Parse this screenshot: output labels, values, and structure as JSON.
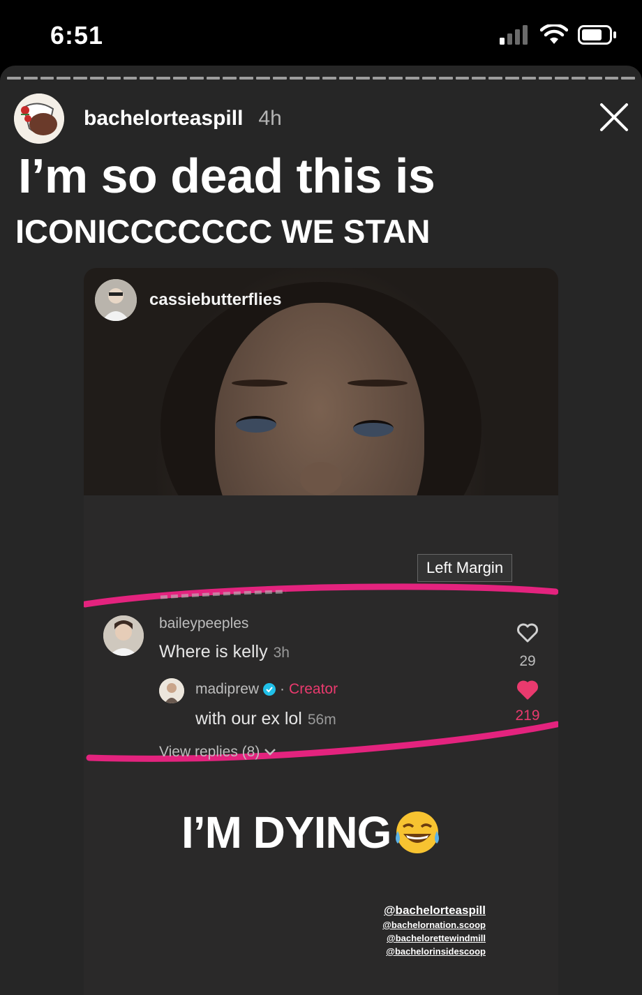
{
  "status": {
    "time": "6:51"
  },
  "story": {
    "username": "bachelorteaspill",
    "time_ago": "4h",
    "caption_line1": "I’m so dead this is",
    "caption_line2": "ICONICCCCCCC WE STAN",
    "progress_segments": 38
  },
  "post": {
    "username": "cassiebutterflies",
    "tooltip": "Left Margin",
    "comment": {
      "user": "baileypeeples",
      "text": "Where is kelly",
      "time": "3h",
      "likes": "29"
    },
    "reply": {
      "user": "madiprew",
      "badge": "Creator",
      "text": "with our ex lol",
      "time": "56m",
      "likes": "219"
    },
    "view_replies": "View replies (8)",
    "overlay_text": "I’M DYING",
    "credits": [
      "@bachelorteaspill",
      "@bachelornation.scoop",
      "@bachelorettewindmill",
      "@bachelorinsidescoop"
    ]
  },
  "colors": {
    "accent_pink": "#e3237e",
    "like_red": "#ea3a6e",
    "verified_blue": "#20c0e8"
  }
}
